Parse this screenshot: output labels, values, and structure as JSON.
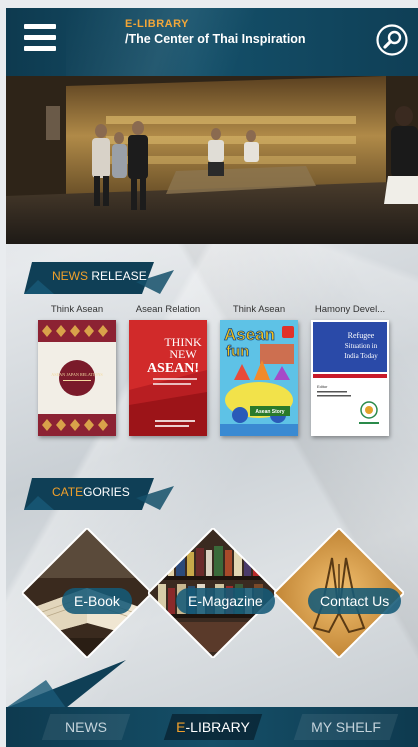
{
  "header": {
    "brand": "E-LIBRARY",
    "tagline": "/The Center of Thai Inspiration",
    "menu_icon": "hamburger-icon",
    "search_icon": "search-icon"
  },
  "colors": {
    "navy": "#0e3a4f",
    "teal": "#14506a",
    "accent": "#f1a02b",
    "white": "#ffffff"
  },
  "news": {
    "heading_highlight": "NEWS",
    "heading_rest": " RELEASE",
    "books": [
      {
        "title": "Think Asean",
        "cover": {
          "text": "ASEAN JAPAN RELATIONS"
        }
      },
      {
        "title": "Asean Relation",
        "cover": {
          "text_1": "THINK",
          "text_2": "NEW",
          "text_3": "ASEAN!"
        }
      },
      {
        "title": "Think Asean",
        "cover": {
          "text_1": "Asean",
          "text_2": "fun",
          "text_3": "Asean Story"
        }
      },
      {
        "title": "Hamony Devel...",
        "cover": {
          "text_1": "Refugee",
          "text_2": "Situation in",
          "text_3": "India Today",
          "editor": "Editor"
        }
      }
    ]
  },
  "categories": {
    "heading_highlight": "CATE",
    "heading_rest": "GORIES",
    "items": [
      {
        "label": "E-Book"
      },
      {
        "label": "E-Magazine"
      },
      {
        "label": "Contact Us"
      }
    ]
  },
  "bottom_nav": {
    "tabs": [
      {
        "label": "NEWS",
        "active": false
      },
      {
        "label": "E-LIBRARY",
        "active": true
      },
      {
        "label": "MY SHELF",
        "active": false
      }
    ]
  }
}
